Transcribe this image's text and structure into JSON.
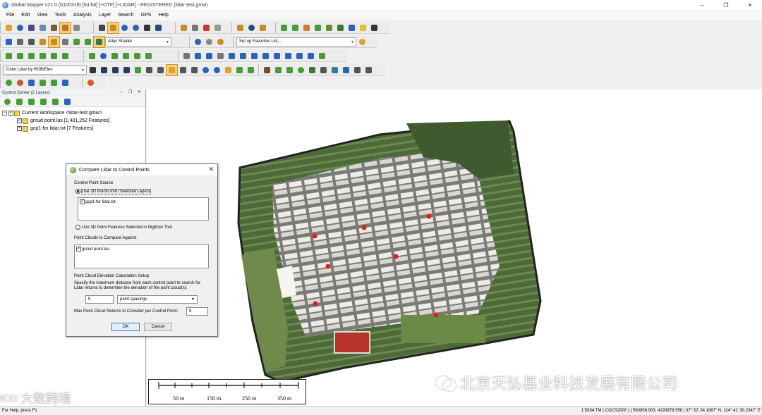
{
  "window": {
    "title": "Global Mapper v21.0 (b100319) [64-bit] [+OTF] [+LIDAR] - REGISTERED (lidar-test.gmw)",
    "minimize": "─",
    "maximize": "❐",
    "close": "✕"
  },
  "menu": [
    "File",
    "Edit",
    "View",
    "Tools",
    "Analysis",
    "Layer",
    "Search",
    "GPS",
    "Help"
  ],
  "toolbar": {
    "shader_select": "Atlas Shader",
    "favorites_select": "Set up Favorites List...",
    "lidar_color_select": "Color Lidar by RGB/Elev",
    "colors": {
      "accent": "#f5d37c",
      "green": "#4a9a3a",
      "blue": "#2a63b8",
      "red": "#cc3333",
      "orange": "#e2a032"
    }
  },
  "control_center": {
    "title": "Control Center (2 Layers)",
    "window_buttons": "─ ❐ ✕",
    "workspace": "Current Workspace <lidar-test.gmw>",
    "layers": [
      "groud point.las [1,401,252 Features]",
      "gcp1-for lidar.txt [7 Features]"
    ]
  },
  "dialog": {
    "title": "Compare Lidar to Control Points",
    "close": "✕",
    "section_source": "Control Point Source",
    "radio_selected_layers": "Use 3D Points from Selected Layers",
    "source_list": [
      "gcp1-for lidar.txt"
    ],
    "radio_digitizer": "Use 3D Point Features Selected in Digitizer Tool",
    "section_point_clouds": "Point Clouds to Compare Against",
    "cloud_list": [
      "groud point.las"
    ],
    "section_elevation": "Point Cloud Elevation Calculation Setup",
    "description_line1": "Specify the maximum distance from each control point to search for",
    "description_line2": "Lidar returns to determine the elevation of the point cloud(s):",
    "distance_value": "5",
    "distance_unit": "point spacings",
    "max_returns_label": "Max Point Cloud Returns to Consider per Control Point:",
    "max_returns_value": "9",
    "ok": "OK",
    "cancel": "Cancel"
  },
  "scale_bar": {
    "labels": [
      "50 m",
      "150 m",
      "250 m",
      "350 m"
    ]
  },
  "status": {
    "left": "For Help, press F1",
    "right": "1:5834  TM ( CGCS2000 ) | 560858.903, 4193978.558 | 37° 52' 34.1967\" N, 114° 41' 30.2347\" E"
  },
  "watermark": {
    "main": "北京天弘基业科技发展有限公司",
    "left_logo": "ICO",
    "left": "大数跨境"
  }
}
